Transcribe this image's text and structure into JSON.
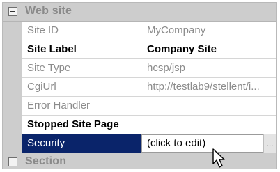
{
  "sections": {
    "web_site": "Web site",
    "section": "Section"
  },
  "properties": [
    {
      "name": "Site ID",
      "value": "MyCompany"
    },
    {
      "name": "Site Label",
      "value": "Company Site"
    },
    {
      "name": "Site Type",
      "value": "hcsp/jsp"
    },
    {
      "name": "CgiUrl",
      "value": "http://testlab9/stellent/i..."
    },
    {
      "name": "Error Handler",
      "value": ""
    },
    {
      "name": "Stopped Site Page",
      "value": ""
    },
    {
      "name": "Security",
      "value": "(click to edit)"
    }
  ],
  "ellipsis_button": "...",
  "icons": {
    "collapse": "collapse-minus-icon",
    "pointer": "mouse-pointer-icon"
  },
  "colors": {
    "selected_row": "#0a246a",
    "section_header": "#cdcdcd",
    "muted_text": "#8c8c8c"
  }
}
